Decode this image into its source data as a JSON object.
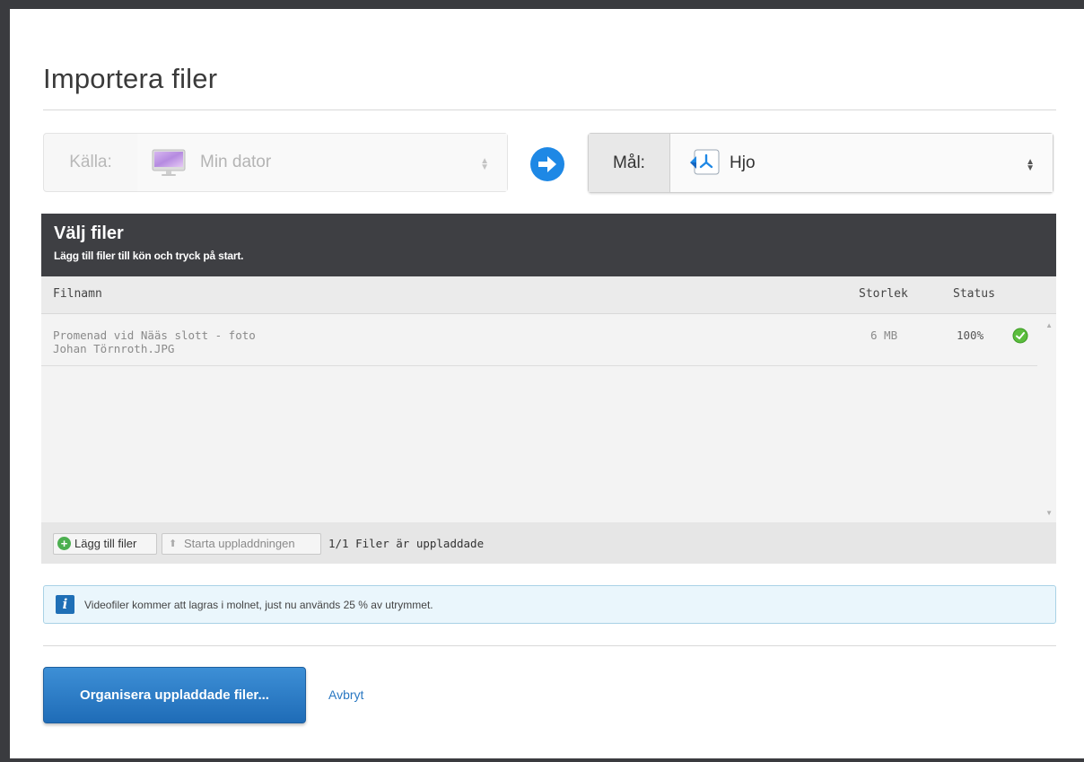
{
  "dialog": {
    "title": "Importera filer"
  },
  "source": {
    "label": "Källa:",
    "value": "Min dator",
    "icon": "computer-monitor-icon"
  },
  "target": {
    "label": "Mål:",
    "value": "Hjo",
    "icon": "album-icon"
  },
  "panel": {
    "title": "Välj filer",
    "subtitle": "Lägg till filer till kön och tryck på start."
  },
  "table": {
    "columns": [
      "Filnamn",
      "Storlek",
      "Status"
    ],
    "rows": [
      {
        "filename_line1": "Promenad vid Nääs slott - foto",
        "filename_line2": "Johan Törnroth.JPG",
        "size": "6 MB",
        "status": "100%",
        "status_icon": "check-circle-icon"
      }
    ]
  },
  "toolbar": {
    "add_label": "Lägg till filer",
    "start_label": "Starta uppladdningen",
    "status": "1/1 Filer är uppladdade"
  },
  "info": {
    "text": "Videofiler kommer att lagras i molnet, just nu används 25 % av utrymmet."
  },
  "actions": {
    "primary_label": "Organisera uppladdade filer...",
    "cancel_label": "Avbryt"
  },
  "colors": {
    "accent": "#1e88e5",
    "header_dark": "#3e3f43",
    "success": "#4caf50"
  }
}
